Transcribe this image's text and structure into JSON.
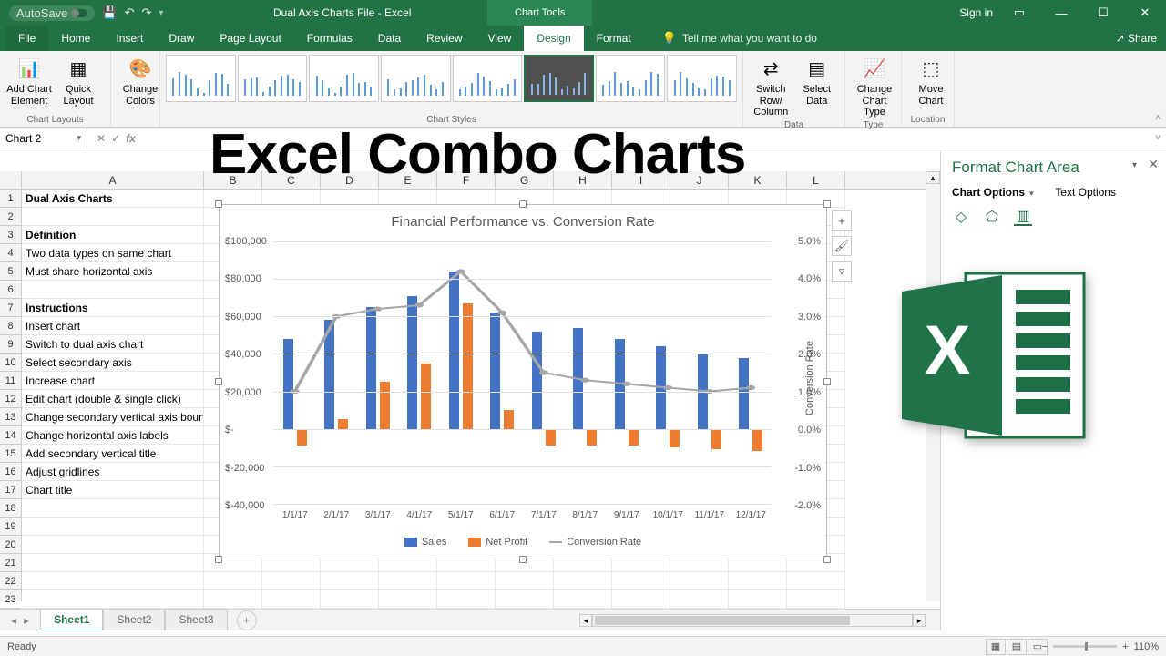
{
  "titlebar": {
    "autosave": "AutoSave",
    "doc_title": "Dual Axis Charts File  -  Excel",
    "chart_tools": "Chart Tools",
    "signin": "Sign in"
  },
  "tabs": {
    "file": "File",
    "home": "Home",
    "insert": "Insert",
    "draw": "Draw",
    "page_layout": "Page Layout",
    "formulas": "Formulas",
    "data": "Data",
    "review": "Review",
    "view": "View",
    "design": "Design",
    "format": "Format",
    "tell_me": "Tell me what you want to do",
    "share": "Share"
  },
  "ribbon": {
    "add_chart_element": "Add Chart Element",
    "quick_layout": "Quick Layout",
    "change_colors": "Change Colors",
    "chart_layouts": "Chart Layouts",
    "chart_styles": "Chart Styles",
    "switch_rc": "Switch Row/ Column",
    "select_data": "Select Data",
    "data_group": "Data",
    "change_chart_type": "Change Chart Type",
    "type_group": "Type",
    "move_chart": "Move Chart",
    "location_group": "Location"
  },
  "name_box": "Chart 2",
  "big_title": "Excel Combo Charts",
  "columns": [
    "A",
    "B",
    "C",
    "D",
    "E",
    "F",
    "G",
    "H",
    "I",
    "J",
    "K",
    "L"
  ],
  "rows_a": [
    {
      "t": "Dual Axis Charts",
      "b": true
    },
    {
      "t": ""
    },
    {
      "t": "Definition",
      "b": true
    },
    {
      "t": "Two data types on same chart"
    },
    {
      "t": "Must share horizontal axis"
    },
    {
      "t": ""
    },
    {
      "t": "Instructions",
      "b": true
    },
    {
      "t": "Insert chart"
    },
    {
      "t": "Switch to dual axis chart"
    },
    {
      "t": "Select secondary axis"
    },
    {
      "t": "Increase chart"
    },
    {
      "t": "Edit chart (double & single click)"
    },
    {
      "t": "Change secondary vertical axis bounds"
    },
    {
      "t": "Change horizontal axis labels"
    },
    {
      "t": "Add secondary vertical title"
    },
    {
      "t": "Adjust gridlines"
    },
    {
      "t": "Chart title"
    },
    {
      "t": ""
    },
    {
      "t": ""
    },
    {
      "t": ""
    },
    {
      "t": ""
    },
    {
      "t": ""
    },
    {
      "t": ""
    },
    {
      "t": ""
    }
  ],
  "chart": {
    "title": "Financial Performance vs. Conversion Rate",
    "y1_labels": [
      "$100,000",
      "$80,000",
      "$60,000",
      "$40,000",
      "$20,000",
      "$-",
      "$-20,000",
      "$-40,000"
    ],
    "y2_labels": [
      "5.0%",
      "4.0%",
      "3.0%",
      "2.0%",
      "1.0%",
      "0.0%",
      "-1.0%",
      "-2.0%"
    ],
    "axis2_title": "Conversion Rate",
    "legend": {
      "sales": "Sales",
      "profit": "Net Profit",
      "conv": "Conversion Rate"
    }
  },
  "chart_data": {
    "type": "combo",
    "categories": [
      "1/1/17",
      "2/1/17",
      "3/1/17",
      "4/1/17",
      "5/1/17",
      "6/1/17",
      "7/1/17",
      "8/1/17",
      "9/1/17",
      "10/1/17",
      "11/1/17",
      "12/1/17"
    ],
    "primary_axis": {
      "label": "",
      "min": -40000,
      "max": 100000,
      "format": "$"
    },
    "secondary_axis": {
      "label": "Conversion Rate",
      "min": -0.02,
      "max": 0.05,
      "format": "%"
    },
    "series": [
      {
        "name": "Sales",
        "type": "bar",
        "axis": "primary",
        "color": "#4472c4",
        "values": [
          48000,
          58000,
          65000,
          71000,
          84000,
          62000,
          52000,
          54000,
          48000,
          44000,
          40000,
          38000
        ]
      },
      {
        "name": "Net Profit",
        "type": "bar",
        "axis": "primary",
        "color": "#ed7d31",
        "values": [
          -9000,
          5000,
          25000,
          35000,
          67000,
          10000,
          -9000,
          -9000,
          -9000,
          -10000,
          -11000,
          -12000
        ]
      },
      {
        "name": "Conversion Rate",
        "type": "line",
        "axis": "secondary",
        "color": "#a6a6a6",
        "values": [
          0.01,
          0.03,
          0.032,
          0.033,
          0.042,
          0.031,
          0.015,
          0.013,
          0.012,
          0.011,
          0.01,
          0.011
        ]
      }
    ]
  },
  "format_pane": {
    "title": "Format Chart Area",
    "chart_options": "Chart Options",
    "text_options": "Text Options"
  },
  "sheets": [
    "Sheet1",
    "Sheet2",
    "Sheet3"
  ],
  "status": {
    "ready": "Ready",
    "zoom": "110%"
  }
}
